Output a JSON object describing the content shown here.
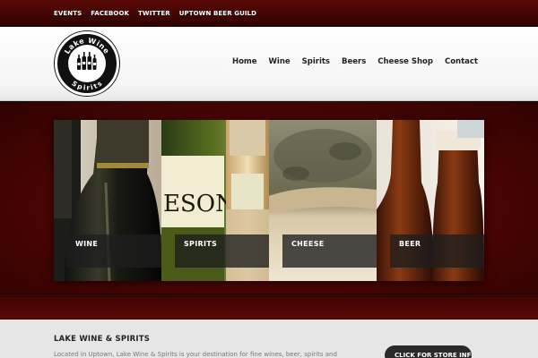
{
  "topbar": {
    "links": [
      "EVENTS",
      "FACEBOOK",
      "TWITTER",
      "UPTOWN BEER GUILD"
    ]
  },
  "logo": {
    "line1": "Lake Wine",
    "line2": "Spirits"
  },
  "nav": {
    "items": [
      "Home",
      "Wine",
      "Spirits",
      "Beers",
      "Cheese Shop",
      "Contact"
    ]
  },
  "tiles": [
    {
      "label": "WINE",
      "icon": "wine-bottle-photo"
    },
    {
      "label": "SPIRITS",
      "icon": "spirits-bottle-photo",
      "bottle_text": "ESON"
    },
    {
      "label": "CHEESE",
      "icon": "cheese-photo"
    },
    {
      "label": "BEER",
      "icon": "beer-bottle-photo"
    }
  ],
  "about": {
    "title": "LAKE WINE & SPIRITS",
    "text": "Located in Uptown, Lake Wine & Spirits is your destination for fine wines, beer, spirits and",
    "button": "CLICK FOR STORE INFO"
  },
  "colors": {
    "topbar": "#3a0402",
    "banner": "#4a0503",
    "button": "#2a2a2a"
  }
}
